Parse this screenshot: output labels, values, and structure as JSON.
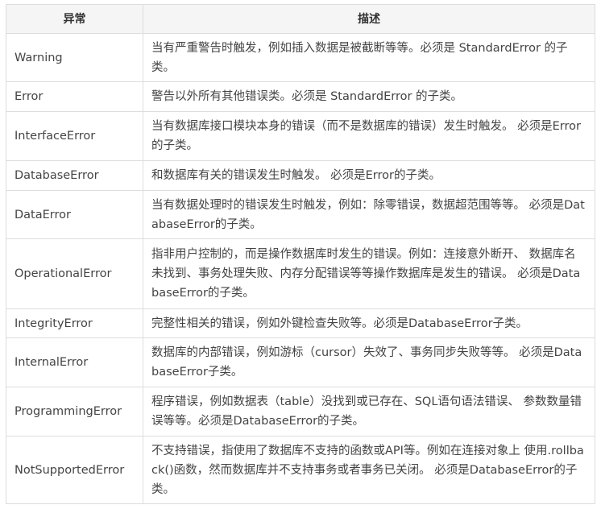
{
  "table": {
    "headers": {
      "exception": "异常",
      "description": "描述"
    },
    "rows": [
      {
        "name": "Warning",
        "description": "当有严重警告时触发，例如插入数据是被截断等等。必须是 StandardError 的子类。"
      },
      {
        "name": "Error",
        "description": "警告以外所有其他错误类。必须是 StandardError 的子类。"
      },
      {
        "name": "InterfaceError",
        "description": "当有数据库接口模块本身的错误（而不是数据库的错误）发生时触发。 必须是Error的子类。"
      },
      {
        "name": "DatabaseError",
        "description": "和数据库有关的错误发生时触发。 必须是Error的子类。"
      },
      {
        "name": "DataError",
        "description": "当有数据处理时的错误发生时触发，例如：除零错误，数据超范围等等。 必须是DatabaseError的子类。"
      },
      {
        "name": "OperationalError",
        "description": "指非用户控制的，而是操作数据库时发生的错误。例如：连接意外断开、 数据库名未找到、事务处理失败、内存分配错误等等操作数据库是发生的错误。 必须是DatabaseError的子类。"
      },
      {
        "name": "IntegrityError",
        "description": "完整性相关的错误，例如外键检查失败等。必须是DatabaseError子类。"
      },
      {
        "name": "InternalError",
        "description": "数据库的内部错误，例如游标（cursor）失效了、事务同步失败等等。 必须是DatabaseError子类。"
      },
      {
        "name": "ProgrammingError",
        "description": "程序错误，例如数据表（table）没找到或已存在、SQL语句语法错误、 参数数量错误等等。必须是DatabaseError的子类。"
      },
      {
        "name": "NotSupportedError",
        "description": "不支持错误，指使用了数据库不支持的函数或API等。例如在连接对象上 使用.rollback()函数，然而数据库并不支持事务或者事务已关闭。 必须是DatabaseError的子类。"
      }
    ]
  }
}
